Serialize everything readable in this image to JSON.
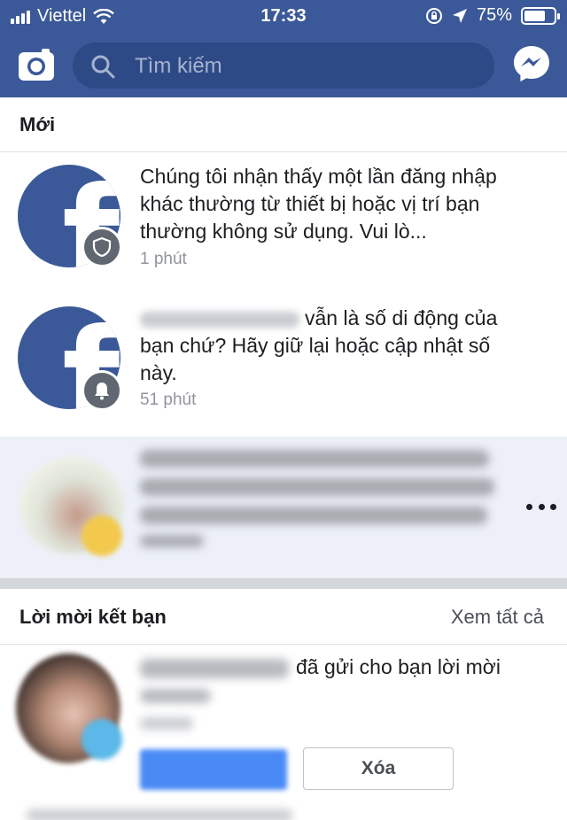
{
  "status_bar": {
    "carrier": "Viettel",
    "time": "17:33",
    "battery_percent": "75%",
    "battery_level": 0.75
  },
  "search": {
    "placeholder": "Tìm kiếm"
  },
  "icons": {
    "camera": "camera-icon",
    "search": "search-icon",
    "messenger": "messenger-icon",
    "shield": "shield-icon",
    "bell": "bell-icon",
    "more": "more-icon"
  },
  "colors": {
    "header": "#3b5998",
    "unread_bg": "#edf0f8",
    "muted_text": "#90949c"
  },
  "sections": {
    "new_title": "Mới",
    "friend_requests_title": "Lời mời kết bạn",
    "see_all": "Xem tất cả"
  },
  "notifications": [
    {
      "text": "Chúng tôi nhận thấy một lần đăng nhập khác thường từ thiết bị hoặc vị trí bạn thường không sử dụng. Vui lò...",
      "time": "1 phút",
      "badge_icon": "shield-icon"
    },
    {
      "text": "vẫn là số di động của bạn chứ? Hãy giữ lại hoặc cập nhật số này.",
      "time": "51 phút",
      "badge_icon": "bell-icon"
    }
  ],
  "friend_request": {
    "text": "đã gửi cho bạn lời mời",
    "delete_label": "Xóa"
  }
}
